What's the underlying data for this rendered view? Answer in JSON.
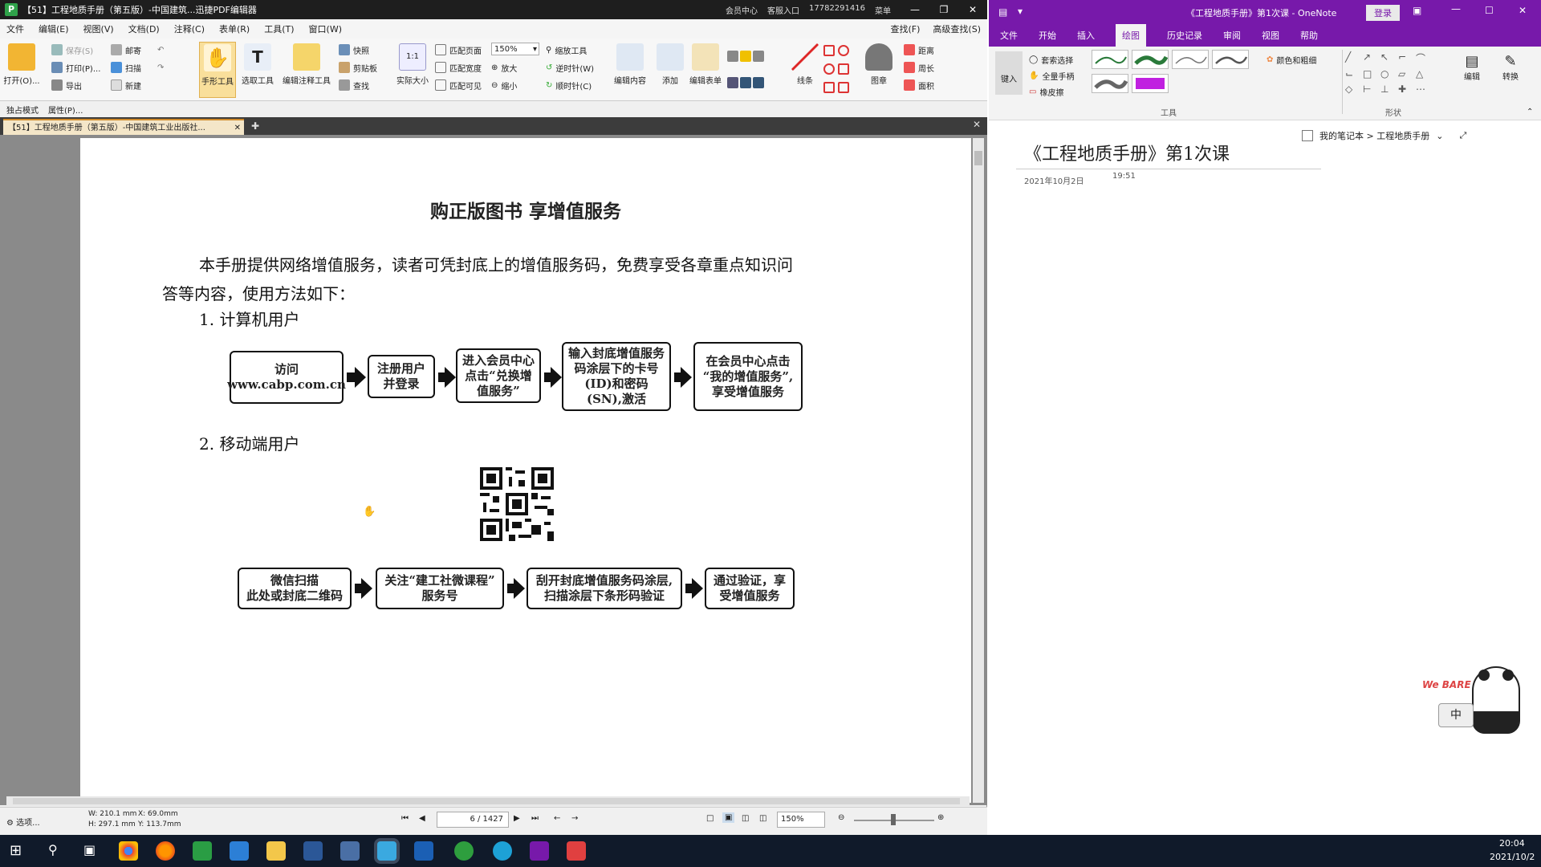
{
  "pdf": {
    "title": "【51】工程地质手册（第五版）-中国建筑...迅捷PDF编辑器",
    "title_right": [
      "会员中心",
      "客服入口",
      "17782291416",
      "菜单"
    ],
    "menu": [
      "文件",
      "编辑(E)",
      "视图(V)",
      "文档(D)",
      "注释(C)",
      "表单(R)",
      "工具(T)",
      "窗口(W)"
    ],
    "menu_right": [
      "查找(F)",
      "高级查找(S)"
    ],
    "ribbon": {
      "open": "打开(O)...",
      "save": "保存(S)",
      "print": "打印(P)...",
      "export": "导出",
      "mail": "邮寄",
      "scan": "扫描",
      "new": "新建",
      "hand": "手形工具",
      "select": "选取工具",
      "edit_annot": "编辑注释工具",
      "snapshot": "快照",
      "clipboard": "剪贴板",
      "find": "查找",
      "actual_size": "实际大小",
      "fit_page": "匹配页面",
      "fit_width": "匹配宽度",
      "fit_visible": "匹配可见",
      "zoom_value": "150%",
      "zoom_tool": "缩放工具",
      "zoom_in": "放大",
      "zoom_out": "缩小",
      "rotate_ccw": "逆时针(W)",
      "rotate_cw": "顺时针(C)",
      "edit_content": "编辑内容",
      "add": "添加",
      "edit_form": "编辑表单",
      "line": "线条",
      "stamp": "图章",
      "distance": "距离",
      "perimeter": "周长",
      "area": "面积"
    },
    "sub": [
      "独占模式",
      "属性(P)..."
    ],
    "tab_label": "【51】工程地质手册（第五版）-中国建筑工业出版社...",
    "status": {
      "options": "选项...",
      "size_w": "W: 210.1 mm",
      "size_h": "H: 297.1 mm",
      "coord_x": "X: 69.0mm",
      "coord_y": "Y: 113.7mm",
      "page": "6 / 1427",
      "zoom": "150%"
    }
  },
  "doc": {
    "title": "购正版图书    享增值服务",
    "intro_line1": "本手册提供网络增值服务，读者可凭封底上的增值服务码，免费享受各章重点知识问",
    "intro_line2": "答等内容，使用方法如下：",
    "section1": "1. 计算机用户",
    "section2": "2. 移动端用户",
    "flow1": [
      "访问\nwww.cabp.com.cn",
      "注册用户\n并登录",
      "进入会员中心\n点击“兑换增\n值服务”",
      "输入封底增值服务\n码涂层下的卡号\n(ID)和密码\n(SN),激活",
      "在会员中心点击\n“我的增值服务”,\n享受增值服务"
    ],
    "flow2": [
      "微信扫描\n此处或封底二维码",
      "关注“建工社微课程”\n服务号",
      "刮开封底增值服务码涂层,\n扫描涂层下条形码验证",
      "通过验证，享\n受增值服务"
    ]
  },
  "onenote": {
    "title": "《工程地质手册》第1次课  -  OneNote",
    "login": "登录",
    "tabs": [
      "文件",
      "开始",
      "插入",
      "绘图",
      "历史记录",
      "审阅",
      "视图",
      "帮助"
    ],
    "active_tab": "绘图",
    "tools": [
      "键入",
      "套索选择",
      "全量手柄",
      "橡皮擦"
    ],
    "groups": [
      "工具",
      "形状"
    ],
    "color_label": "颜色和粗细",
    "edit": "编辑",
    "convert": "转换",
    "notebook_path": "我的笔记本 > 工程地质手册",
    "page_title": "《工程地质手册》第1次课",
    "page_date": "2021年10月2日",
    "page_time": "19:51",
    "sticker_text": "中"
  },
  "taskbar": {
    "time": "20:04",
    "date": "2021/10/2"
  },
  "colors": {
    "onenote_purple": "#7719aa",
    "pdf_title_bg": "#1e1e1e",
    "taskbar_bg": "#101a2a"
  }
}
